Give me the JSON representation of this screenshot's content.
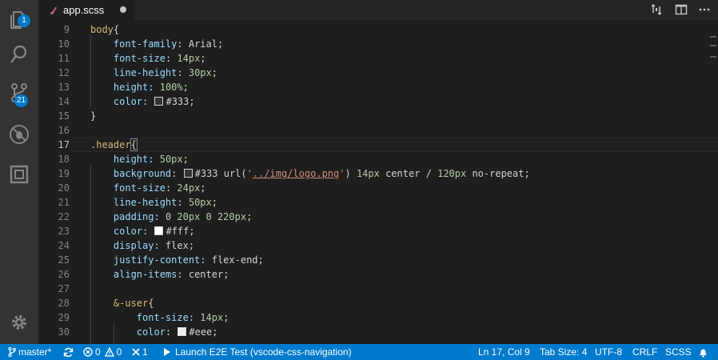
{
  "activity_bar": {
    "explorer_badge": "1",
    "scm_badge": "21"
  },
  "tab": {
    "title": "app.scss"
  },
  "editor": {
    "lines": [
      {
        "n": "9",
        "t": [
          [
            "sel",
            "body"
          ],
          [
            "pun",
            "{"
          ]
        ]
      },
      {
        "n": "10",
        "t": [
          [
            "pun",
            "    "
          ],
          [
            "prop",
            "font-family"
          ],
          [
            "pun",
            ": Arial;"
          ]
        ]
      },
      {
        "n": "11",
        "t": [
          [
            "pun",
            "    "
          ],
          [
            "prop",
            "font-size"
          ],
          [
            "pun",
            ": "
          ],
          [
            "num",
            "14px"
          ],
          [
            "pun",
            ";"
          ]
        ]
      },
      {
        "n": "12",
        "t": [
          [
            "pun",
            "    "
          ],
          [
            "prop",
            "line-height"
          ],
          [
            "pun",
            ": "
          ],
          [
            "num",
            "30px"
          ],
          [
            "pun",
            ";"
          ]
        ]
      },
      {
        "n": "13",
        "t": [
          [
            "pun",
            "    "
          ],
          [
            "prop",
            "height"
          ],
          [
            "pun",
            ": "
          ],
          [
            "num",
            "100%"
          ],
          [
            "pun",
            ";"
          ]
        ]
      },
      {
        "n": "14",
        "t": [
          [
            "pun",
            "    "
          ],
          [
            "prop",
            "color"
          ],
          [
            "pun",
            ": "
          ],
          [
            "sw",
            "#333333"
          ],
          [
            "pun",
            "#333;"
          ]
        ]
      },
      {
        "n": "15",
        "t": [
          [
            "pun",
            "}"
          ]
        ]
      },
      {
        "n": "16",
        "t": []
      },
      {
        "n": "17",
        "t": [
          [
            "sel",
            ".header"
          ],
          [
            "brk",
            "{"
          ]
        ],
        "active": true
      },
      {
        "n": "18",
        "t": [
          [
            "pun",
            "    "
          ],
          [
            "prop",
            "height"
          ],
          [
            "pun",
            ": "
          ],
          [
            "num",
            "50px"
          ],
          [
            "pun",
            ";"
          ]
        ]
      },
      {
        "n": "19",
        "t": [
          [
            "pun",
            "    "
          ],
          [
            "prop",
            "background"
          ],
          [
            "pun",
            ": "
          ],
          [
            "sw",
            "#333333"
          ],
          [
            "pun",
            "#333 url("
          ],
          [
            "str",
            "'"
          ],
          [
            "lnk",
            "../img/logo.png"
          ],
          [
            "str",
            "'"
          ],
          [
            "pun",
            ") "
          ],
          [
            "num",
            "14px"
          ],
          [
            "pun",
            " center / "
          ],
          [
            "num",
            "120px"
          ],
          [
            "pun",
            " no-repeat;"
          ]
        ]
      },
      {
        "n": "20",
        "t": [
          [
            "pun",
            "    "
          ],
          [
            "prop",
            "font-size"
          ],
          [
            "pun",
            ": "
          ],
          [
            "num",
            "24px"
          ],
          [
            "pun",
            ";"
          ]
        ]
      },
      {
        "n": "21",
        "t": [
          [
            "pun",
            "    "
          ],
          [
            "prop",
            "line-height"
          ],
          [
            "pun",
            ": "
          ],
          [
            "num",
            "50px"
          ],
          [
            "pun",
            ";"
          ]
        ]
      },
      {
        "n": "22",
        "t": [
          [
            "pun",
            "    "
          ],
          [
            "prop",
            "padding"
          ],
          [
            "pun",
            ": "
          ],
          [
            "num",
            "0 20px 0 220px"
          ],
          [
            "pun",
            ";"
          ]
        ]
      },
      {
        "n": "23",
        "t": [
          [
            "pun",
            "    "
          ],
          [
            "prop",
            "color"
          ],
          [
            "pun",
            ": "
          ],
          [
            "sw",
            "#ffffff"
          ],
          [
            "pun",
            "#fff;"
          ]
        ]
      },
      {
        "n": "24",
        "t": [
          [
            "pun",
            "    "
          ],
          [
            "prop",
            "display"
          ],
          [
            "pun",
            ": flex;"
          ]
        ]
      },
      {
        "n": "25",
        "t": [
          [
            "pun",
            "    "
          ],
          [
            "prop",
            "justify-content"
          ],
          [
            "pun",
            ": flex-end;"
          ]
        ]
      },
      {
        "n": "26",
        "t": [
          [
            "pun",
            "    "
          ],
          [
            "prop",
            "align-items"
          ],
          [
            "pun",
            ": center;"
          ]
        ]
      },
      {
        "n": "27",
        "t": []
      },
      {
        "n": "28",
        "t": [
          [
            "pun",
            "    "
          ],
          [
            "sel",
            "&-user"
          ],
          [
            "pun",
            "{"
          ]
        ]
      },
      {
        "n": "29",
        "t": [
          [
            "pun",
            "        "
          ],
          [
            "prop",
            "font-size"
          ],
          [
            "pun",
            ": "
          ],
          [
            "num",
            "14px"
          ],
          [
            "pun",
            ";"
          ]
        ]
      },
      {
        "n": "30",
        "t": [
          [
            "pun",
            "        "
          ],
          [
            "prop",
            "color"
          ],
          [
            "pun",
            ": "
          ],
          [
            "sw",
            "#eeeeee"
          ],
          [
            "pun",
            "#eee;"
          ]
        ]
      }
    ]
  },
  "status_bar": {
    "branch": "master*",
    "errors": "0",
    "warnings": "0",
    "tasks": "1",
    "launch": "Launch E2E Test (vscode-css-navigation)",
    "position": "Ln 17, Col 9",
    "tab_size": "Tab Size: 4",
    "encoding": "UTF-8",
    "eol": "CRLF",
    "language": "SCSS"
  },
  "colors": {
    "accent": "#007acc",
    "activity_bar": "#333333",
    "editor_bg": "#1e1e1e"
  }
}
